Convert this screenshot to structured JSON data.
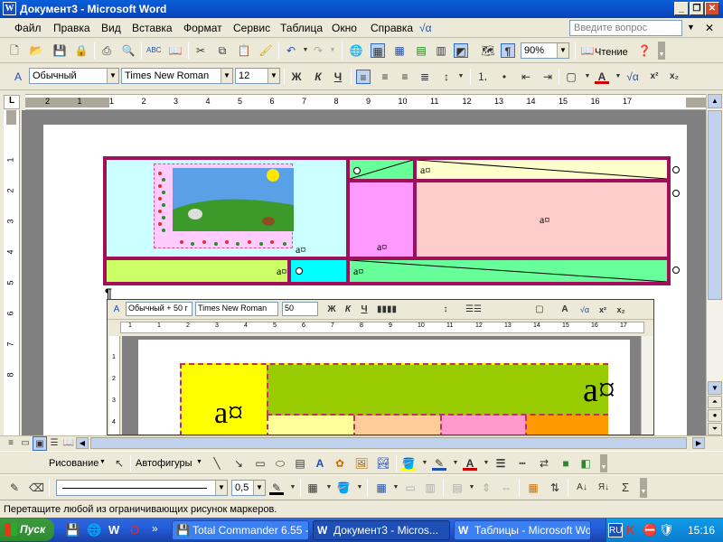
{
  "window": {
    "title": "Документ3 - Microsoft Word",
    "icon": "W"
  },
  "menu": {
    "items": [
      "Файл",
      "Правка",
      "Вид",
      "Вставка",
      "Формат",
      "Сервис",
      "Таблица",
      "Окно",
      "Справка"
    ],
    "ask_placeholder": "Введите вопрос"
  },
  "standard_toolbar": {
    "zoom": "90%",
    "reading": "Чтение"
  },
  "format_toolbar": {
    "style": "Обычный",
    "font": "Times New Roman",
    "size": "12",
    "bold": "Ж",
    "italic": "К",
    "underline": "Ч"
  },
  "ruler": {
    "h_ticks": [
      "2",
      "1",
      "1",
      "2",
      "3",
      "4",
      "5",
      "6",
      "7",
      "8",
      "9",
      "10",
      "11",
      "12",
      "13",
      "14",
      "15",
      "16",
      "17"
    ],
    "v_ticks": [
      "1",
      "2",
      "3",
      "4",
      "5",
      "6",
      "7",
      "8"
    ]
  },
  "document": {
    "cell_marker": "a¤",
    "table_colors": {
      "border": "#a0105a",
      "cyan_light": "#ccffff",
      "green": "#66ff99",
      "pale_yellow": "#ffffcc",
      "pink": "#ff99ff",
      "salmon": "#ffcccc",
      "lime": "#ccff66",
      "cyan": "#00ffff"
    }
  },
  "nested": {
    "style": "Обычный + 50 г",
    "font": "Times New Roman",
    "size": "50",
    "bold": "Ж",
    "italic": "К",
    "underline": "Ч",
    "ruler_ticks": [
      "1",
      "1",
      "2",
      "3",
      "4",
      "5",
      "6",
      "7",
      "8",
      "9",
      "10",
      "11",
      "12",
      "13",
      "14",
      "15",
      "16",
      "17"
    ],
    "v_ticks": [
      "1",
      "2",
      "3",
      "4"
    ],
    "cell_a": "a¤",
    "colors": {
      "yellow": "#ffff00",
      "green": "#99cc00",
      "pale_yellow": "#ffff99",
      "orange_light": "#ffcc99",
      "pink": "#ff99cc",
      "orange": "#ff9900"
    }
  },
  "drawing_toolbar": {
    "drawing": "Рисование",
    "autoshapes": "Автофигуры"
  },
  "line_toolbar": {
    "weight": "0,5"
  },
  "status": {
    "text": "Перетащите любой из ограничивающих рисунок маркеров."
  },
  "taskbar": {
    "start": "Пуск",
    "tasks": [
      "Total Commander 6.55 - ...",
      "Документ3 - Micros...",
      "Таблицы - Microsoft Word"
    ],
    "lang": "RU",
    "clock": "15:16"
  }
}
